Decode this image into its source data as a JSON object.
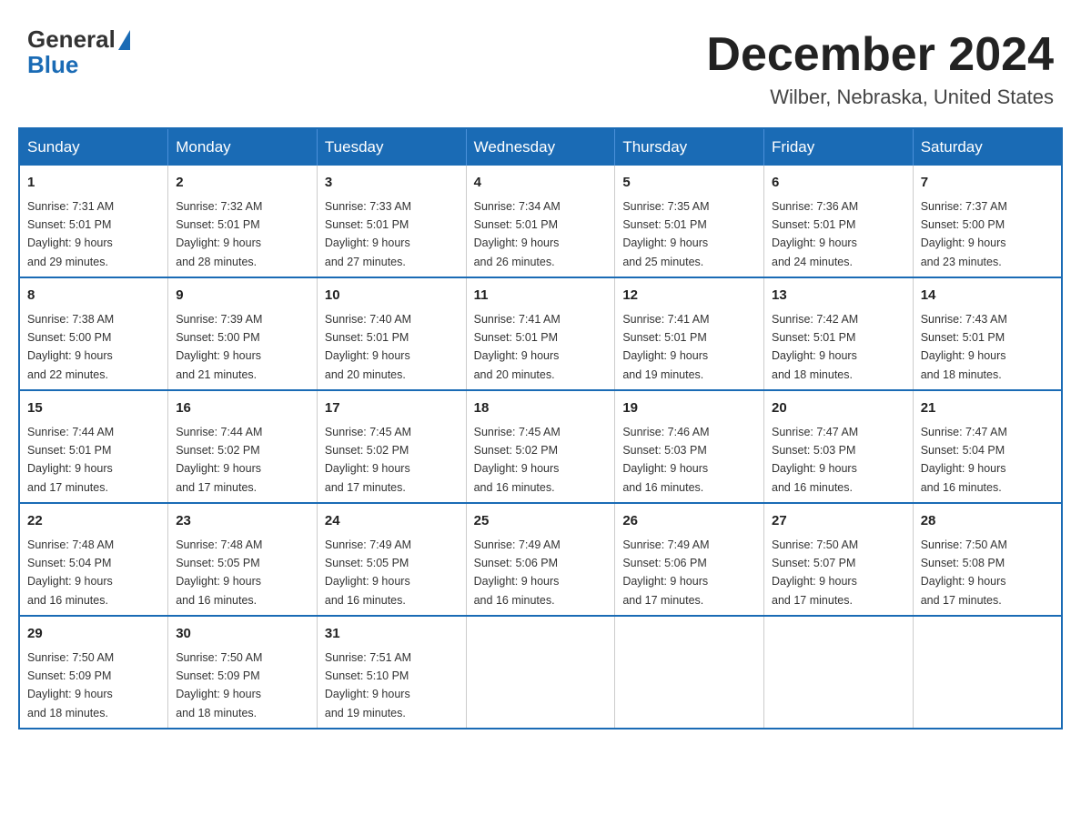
{
  "header": {
    "logo_general": "General",
    "logo_blue": "Blue",
    "month_title": "December 2024",
    "location": "Wilber, Nebraska, United States"
  },
  "days_of_week": [
    "Sunday",
    "Monday",
    "Tuesday",
    "Wednesday",
    "Thursday",
    "Friday",
    "Saturday"
  ],
  "weeks": [
    [
      {
        "day": "1",
        "sunrise": "7:31 AM",
        "sunset": "5:01 PM",
        "daylight": "9 hours and 29 minutes."
      },
      {
        "day": "2",
        "sunrise": "7:32 AM",
        "sunset": "5:01 PM",
        "daylight": "9 hours and 28 minutes."
      },
      {
        "day": "3",
        "sunrise": "7:33 AM",
        "sunset": "5:01 PM",
        "daylight": "9 hours and 27 minutes."
      },
      {
        "day": "4",
        "sunrise": "7:34 AM",
        "sunset": "5:01 PM",
        "daylight": "9 hours and 26 minutes."
      },
      {
        "day": "5",
        "sunrise": "7:35 AM",
        "sunset": "5:01 PM",
        "daylight": "9 hours and 25 minutes."
      },
      {
        "day": "6",
        "sunrise": "7:36 AM",
        "sunset": "5:01 PM",
        "daylight": "9 hours and 24 minutes."
      },
      {
        "day": "7",
        "sunrise": "7:37 AM",
        "sunset": "5:00 PM",
        "daylight": "9 hours and 23 minutes."
      }
    ],
    [
      {
        "day": "8",
        "sunrise": "7:38 AM",
        "sunset": "5:00 PM",
        "daylight": "9 hours and 22 minutes."
      },
      {
        "day": "9",
        "sunrise": "7:39 AM",
        "sunset": "5:00 PM",
        "daylight": "9 hours and 21 minutes."
      },
      {
        "day": "10",
        "sunrise": "7:40 AM",
        "sunset": "5:01 PM",
        "daylight": "9 hours and 20 minutes."
      },
      {
        "day": "11",
        "sunrise": "7:41 AM",
        "sunset": "5:01 PM",
        "daylight": "9 hours and 20 minutes."
      },
      {
        "day": "12",
        "sunrise": "7:41 AM",
        "sunset": "5:01 PM",
        "daylight": "9 hours and 19 minutes."
      },
      {
        "day": "13",
        "sunrise": "7:42 AM",
        "sunset": "5:01 PM",
        "daylight": "9 hours and 18 minutes."
      },
      {
        "day": "14",
        "sunrise": "7:43 AM",
        "sunset": "5:01 PM",
        "daylight": "9 hours and 18 minutes."
      }
    ],
    [
      {
        "day": "15",
        "sunrise": "7:44 AM",
        "sunset": "5:01 PM",
        "daylight": "9 hours and 17 minutes."
      },
      {
        "day": "16",
        "sunrise": "7:44 AM",
        "sunset": "5:02 PM",
        "daylight": "9 hours and 17 minutes."
      },
      {
        "day": "17",
        "sunrise": "7:45 AM",
        "sunset": "5:02 PM",
        "daylight": "9 hours and 17 minutes."
      },
      {
        "day": "18",
        "sunrise": "7:45 AM",
        "sunset": "5:02 PM",
        "daylight": "9 hours and 16 minutes."
      },
      {
        "day": "19",
        "sunrise": "7:46 AM",
        "sunset": "5:03 PM",
        "daylight": "9 hours and 16 minutes."
      },
      {
        "day": "20",
        "sunrise": "7:47 AM",
        "sunset": "5:03 PM",
        "daylight": "9 hours and 16 minutes."
      },
      {
        "day": "21",
        "sunrise": "7:47 AM",
        "sunset": "5:04 PM",
        "daylight": "9 hours and 16 minutes."
      }
    ],
    [
      {
        "day": "22",
        "sunrise": "7:48 AM",
        "sunset": "5:04 PM",
        "daylight": "9 hours and 16 minutes."
      },
      {
        "day": "23",
        "sunrise": "7:48 AM",
        "sunset": "5:05 PM",
        "daylight": "9 hours and 16 minutes."
      },
      {
        "day": "24",
        "sunrise": "7:49 AM",
        "sunset": "5:05 PM",
        "daylight": "9 hours and 16 minutes."
      },
      {
        "day": "25",
        "sunrise": "7:49 AM",
        "sunset": "5:06 PM",
        "daylight": "9 hours and 16 minutes."
      },
      {
        "day": "26",
        "sunrise": "7:49 AM",
        "sunset": "5:06 PM",
        "daylight": "9 hours and 17 minutes."
      },
      {
        "day": "27",
        "sunrise": "7:50 AM",
        "sunset": "5:07 PM",
        "daylight": "9 hours and 17 minutes."
      },
      {
        "day": "28",
        "sunrise": "7:50 AM",
        "sunset": "5:08 PM",
        "daylight": "9 hours and 17 minutes."
      }
    ],
    [
      {
        "day": "29",
        "sunrise": "7:50 AM",
        "sunset": "5:09 PM",
        "daylight": "9 hours and 18 minutes."
      },
      {
        "day": "30",
        "sunrise": "7:50 AM",
        "sunset": "5:09 PM",
        "daylight": "9 hours and 18 minutes."
      },
      {
        "day": "31",
        "sunrise": "7:51 AM",
        "sunset": "5:10 PM",
        "daylight": "9 hours and 19 minutes."
      },
      null,
      null,
      null,
      null
    ]
  ],
  "labels": {
    "sunrise_prefix": "Sunrise: ",
    "sunset_prefix": "Sunset: ",
    "daylight_prefix": "Daylight: "
  }
}
